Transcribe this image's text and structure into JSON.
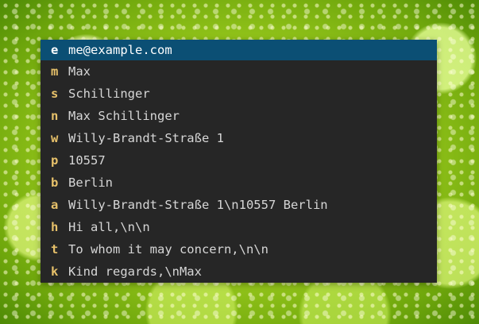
{
  "picker": {
    "items": [
      {
        "key": "e",
        "value": "me@example.com",
        "selected": true
      },
      {
        "key": "m",
        "value": "Max"
      },
      {
        "key": "s",
        "value": "Schillinger"
      },
      {
        "key": "n",
        "value": "Max Schillinger"
      },
      {
        "key": "w",
        "value": "Willy-Brandt-Straße 1"
      },
      {
        "key": "p",
        "value": "10557"
      },
      {
        "key": "b",
        "value": "Berlin"
      },
      {
        "key": "a",
        "value": "Willy-Brandt-Straße 1\\n10557 Berlin"
      },
      {
        "key": "h",
        "value": "Hi all,\\n\\n"
      },
      {
        "key": "t",
        "value": "To whom it may concern,\\n\\n"
      },
      {
        "key": "k",
        "value": "Kind regards,\\nMax"
      }
    ]
  },
  "colors": {
    "background": "#262626",
    "selected_background": "#0b4f74",
    "key_color": "#e7c16a",
    "text_color": "#d6d6d6"
  }
}
